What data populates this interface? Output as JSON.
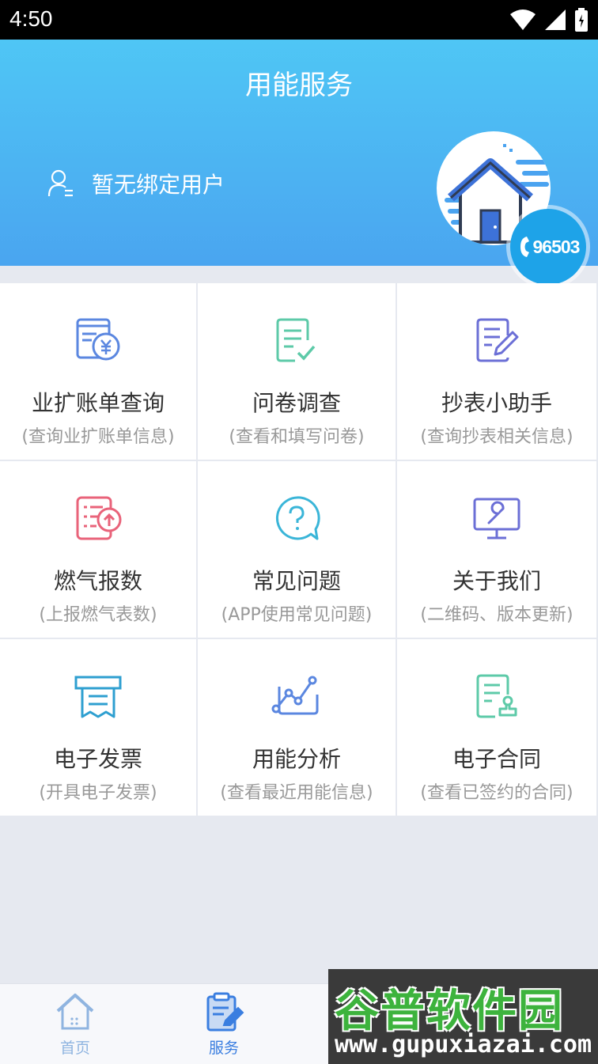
{
  "status": {
    "time": "4:50"
  },
  "header": {
    "title": "用能服务",
    "user_text": "暂无绑定用户",
    "phone": "96503"
  },
  "grid": [
    {
      "name": "bill-query",
      "title": "业扩账单查询",
      "subtitle": "(查询业扩账单信息)",
      "icon": "bill-yuan-icon",
      "color": "#5b87e0"
    },
    {
      "name": "questionnaire",
      "title": "问卷调查",
      "subtitle": "(查看和填写问卷)",
      "icon": "checklist-icon",
      "color": "#5dcaa8"
    },
    {
      "name": "meter-helper",
      "title": "抄表小助手",
      "subtitle": "(查询抄表相关信息)",
      "icon": "edit-doc-icon",
      "color": "#6b6fd6"
    },
    {
      "name": "gas-report",
      "title": "燃气报数",
      "subtitle": "(上报燃气表数)",
      "icon": "upload-list-icon",
      "color": "#e9637a"
    },
    {
      "name": "faq",
      "title": "常见问题",
      "subtitle": "(APP使用常见问题)",
      "icon": "question-bubble-icon",
      "color": "#3ab5d8"
    },
    {
      "name": "about-us",
      "title": "关于我们",
      "subtitle": "(二维码、版本更新)",
      "icon": "monitor-wrench-icon",
      "color": "#6b6fd6"
    },
    {
      "name": "e-invoice",
      "title": "电子发票",
      "subtitle": "(开具电子发票)",
      "icon": "receipt-icon",
      "color": "#2e9fd0"
    },
    {
      "name": "energy-analysis",
      "title": "用能分析",
      "subtitle": "(查看最近用能信息)",
      "icon": "chart-line-icon",
      "color": "#5b87e0"
    },
    {
      "name": "e-contract",
      "title": "电子合同",
      "subtitle": "(查看已签约的合同)",
      "icon": "contract-stamp-icon",
      "color": "#5dcaa8"
    }
  ],
  "tabbar": {
    "home": {
      "label": "首页",
      "color": "#8fb4e0"
    },
    "service": {
      "label": "服务",
      "color": "#3a7ee0"
    }
  },
  "watermark": {
    "top": "谷普软件园",
    "bottom": "www.gupuxiazai.com"
  }
}
